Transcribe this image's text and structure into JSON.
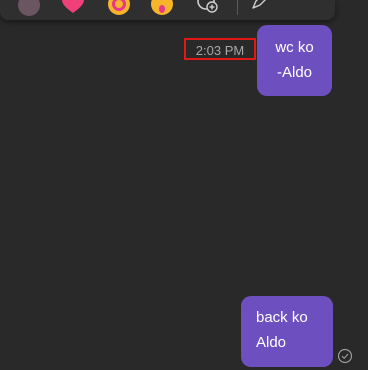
{
  "reactions": {
    "avatar": "avatar-reaction",
    "heart": "heart-icon",
    "laugh": "laughing-emoji-icon",
    "surprised": "surprised-emoji-icon",
    "more": "add-reaction-icon",
    "reply": "reply-icon"
  },
  "messages": [
    {
      "time": "2:03 PM",
      "text": "wc ko\n-Aldo"
    },
    {
      "text": "back ko\nAldo"
    }
  ],
  "colors": {
    "background": "#292929",
    "bubble": "#6e4fc0",
    "timestamp_highlight": "#e01818",
    "timestamp_text": "#a8a8a8"
  }
}
